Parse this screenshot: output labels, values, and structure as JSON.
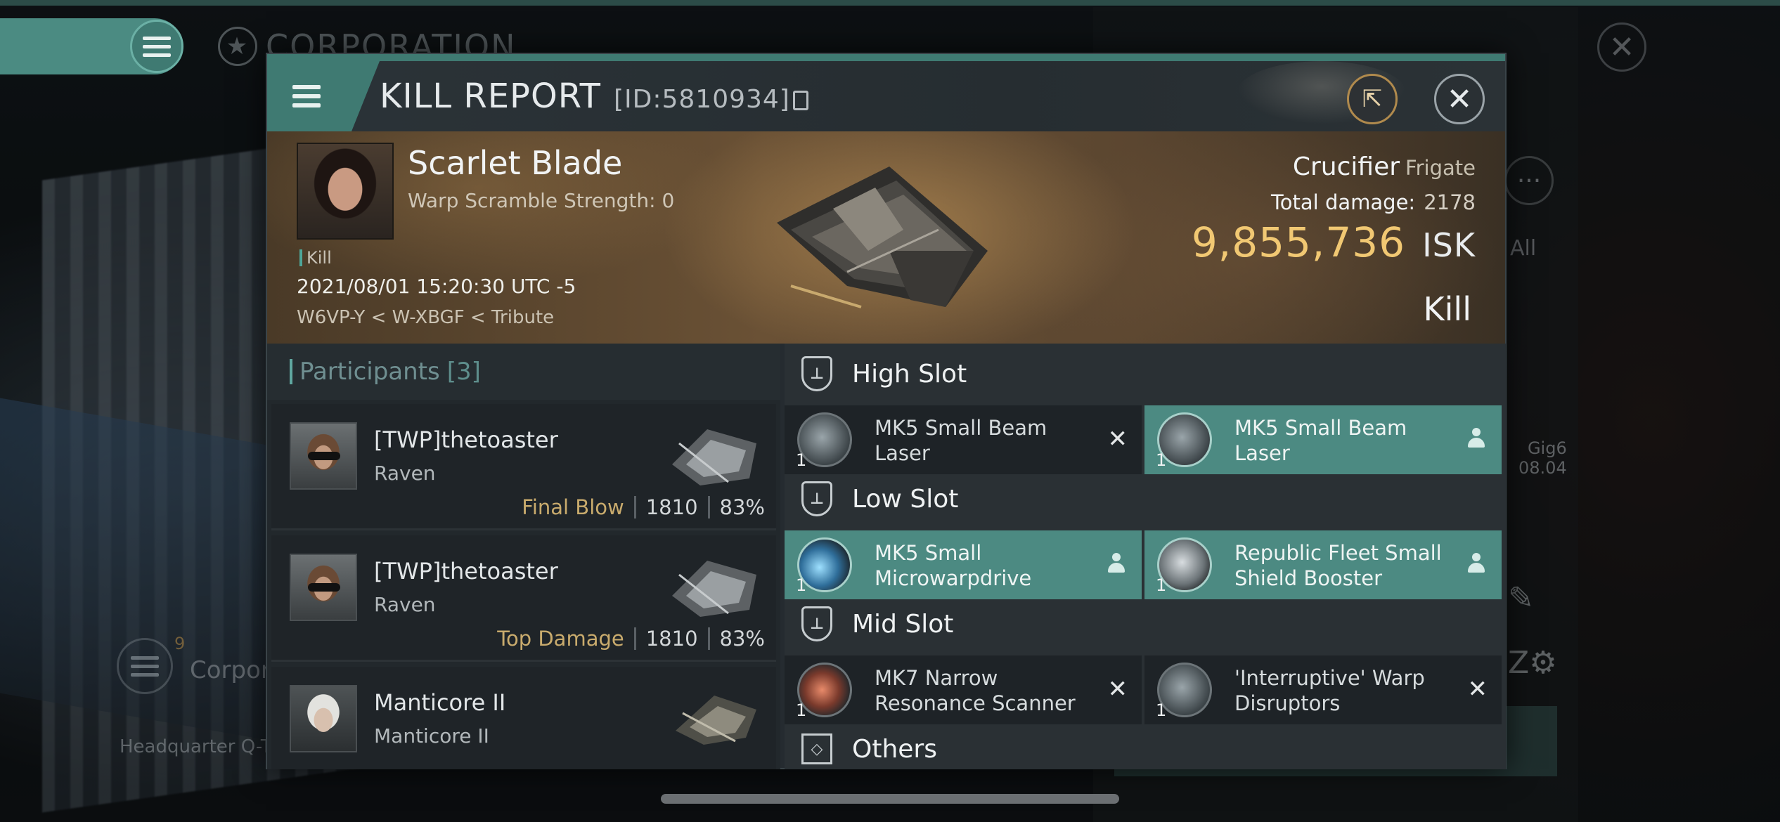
{
  "background": {
    "corporation_title": "CORPORATION",
    "all_label": "All",
    "gig_label": "Gig6",
    "gig_date": "08.04",
    "corp_count": "9",
    "corp_label": "Corpor",
    "hq_label": "Headquarter Q-T"
  },
  "kill_report": {
    "title": "KILL REPORT",
    "id": "[ID:5810934]",
    "victim": {
      "name": "Scarlet Blade",
      "warp_scramble": "Warp Scramble Strength: 0",
      "tag": "Kill",
      "datetime": "2021/08/01 15:20:30 UTC -5",
      "location": "W6VP-Y < W-XBGF < Tribute"
    },
    "ship": {
      "name": "Crucifier",
      "class": "Frigate",
      "total_damage_label": "Total damage:",
      "total_damage": "2178",
      "isk_value": "9,855,736",
      "isk_unit": "ISK",
      "result": "Kill"
    },
    "participants": {
      "label": "Participants",
      "count": "[3]",
      "rows": [
        {
          "name": "[TWP]thetoaster",
          "ship": "Raven",
          "badge": "Final Blow",
          "damage": "1810",
          "percent": "83%"
        },
        {
          "name": "[TWP]thetoaster",
          "ship": "Raven",
          "badge": "Top Damage",
          "damage": "1810",
          "percent": "83%"
        },
        {
          "name": "Manticore II",
          "ship": "Manticore II",
          "badge": "",
          "damage": "",
          "percent": ""
        }
      ]
    },
    "slots": {
      "high": {
        "label": "High Slot",
        "items": [
          {
            "name": "MK5 Small Beam Laser",
            "qty": "1",
            "state": "destroyed"
          },
          {
            "name": "MK5 Small Beam Laser",
            "qty": "1",
            "state": "dropped"
          }
        ]
      },
      "low": {
        "label": "Low Slot",
        "items": [
          {
            "name": "MK5 Small Microwarpdrive",
            "qty": "1",
            "state": "dropped"
          },
          {
            "name": "Republic Fleet Small Shield Booster",
            "qty": "1",
            "state": "dropped"
          }
        ]
      },
      "mid": {
        "label": "Mid Slot",
        "items": [
          {
            "name": "MK7 Narrow Resonance Scanner",
            "qty": "1",
            "state": "destroyed"
          },
          {
            "name": "'Interruptive' Warp Disruptors",
            "qty": "1",
            "state": "destroyed"
          }
        ]
      },
      "others": {
        "label": "Others"
      }
    }
  },
  "icons": {
    "close_glyph": "✕",
    "destroyed_glyph": "✕",
    "share_glyph": "⇱",
    "star_glyph": "★"
  },
  "colors": {
    "accent": "#3f7a72",
    "isk": "#f1c873",
    "final_blow": "#c9ab6d",
    "fitted_item": "#4c8a82"
  }
}
